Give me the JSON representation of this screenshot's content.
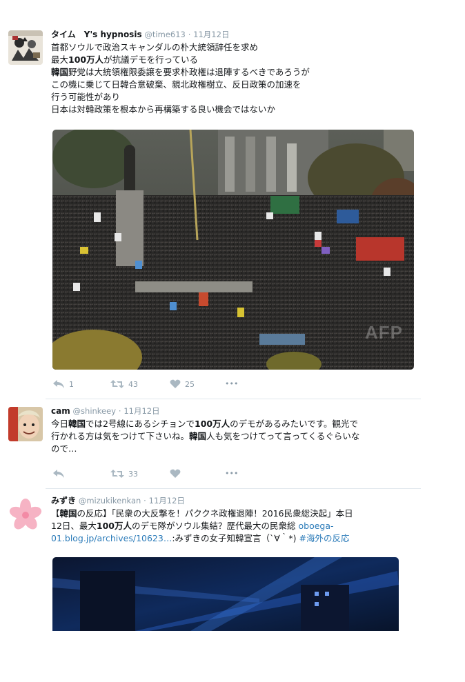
{
  "tweets": [
    {
      "name": "タイム　Y's hypnosis",
      "handle": "@time613",
      "sep": "·",
      "date": "11月12日",
      "lines": [
        [
          {
            "t": "首都ソウルで政治スキャンダルの朴大統領辞任を求め"
          }
        ],
        [
          {
            "t": "最大"
          },
          {
            "t": "100万人",
            "b": true
          },
          {
            "t": "が抗議デモを行っている"
          }
        ],
        [
          {
            "t": "韓国",
            "b": true
          },
          {
            "t": "野党は大統領権限委譲を要求朴政権は退陣するべきであろうが"
          }
        ],
        [
          {
            "t": "この機に乗じて日韓合意破棄、親北政権樹立、反日政策の加速を"
          }
        ],
        [
          {
            "t": "行う可能性があり"
          }
        ],
        [
          {
            "t": "日本は対韓政策を根本から再構築する良い機会ではないか"
          }
        ]
      ],
      "image_alt": "Crowd protest photo",
      "watermark": "AFP",
      "reply_count": "1",
      "retweet_count": "43",
      "like_count": "25"
    },
    {
      "name": "cam",
      "handle": "@shinkeey",
      "sep": "·",
      "date": "11月12日",
      "lines": [
        [
          {
            "t": "今日"
          },
          {
            "t": "韓国",
            "b": true
          },
          {
            "t": "では2号線にあるシチョンで"
          },
          {
            "t": "100万人",
            "b": true
          },
          {
            "t": "のデモがあるみたいです。観光で"
          }
        ],
        [
          {
            "t": "行かれる方は気をつけて下さいね。"
          },
          {
            "t": "韓国",
            "b": true
          },
          {
            "t": "人も気をつけてって言ってくるぐらいな"
          }
        ],
        [
          {
            "t": "ので…"
          }
        ]
      ],
      "reply_count": "",
      "retweet_count": "33",
      "like_count": ""
    },
    {
      "name": "みずき",
      "handle": "@mizukikenkan",
      "sep": "·",
      "date": "11月12日",
      "lines": [
        [
          {
            "t": "【"
          },
          {
            "t": "韓国",
            "b": true
          },
          {
            "t": "の反応】「民衆の大反撃を！パククネ政権退陣！2016民衆総決起」本日"
          }
        ],
        [
          {
            "t": "12日、最大"
          },
          {
            "t": "100万人",
            "b": true
          },
          {
            "t": "のデモ隊がソウル集結？歴代最大の民衆総 "
          },
          {
            "t": "oboega-",
            "link": true
          }
        ],
        [
          {
            "t": "01.blog.jp/archives/10623…",
            "link": true
          },
          {
            "t": ":みずきの女子知韓宣言（`∀｀*) "
          },
          {
            "t": "#海外の反応",
            "link": true
          }
        ]
      ],
      "image_alt": "Night light show photo"
    }
  ],
  "icons": {
    "reply": "reply-arrow-icon",
    "retweet": "retweet-icon",
    "like": "heart-icon",
    "more": "more-dots-icon"
  },
  "more_label": "•••",
  "colors": {
    "text": "#14171a",
    "muted": "#8899a6",
    "link": "#2b7bb9",
    "divider": "#e1e8ed"
  }
}
